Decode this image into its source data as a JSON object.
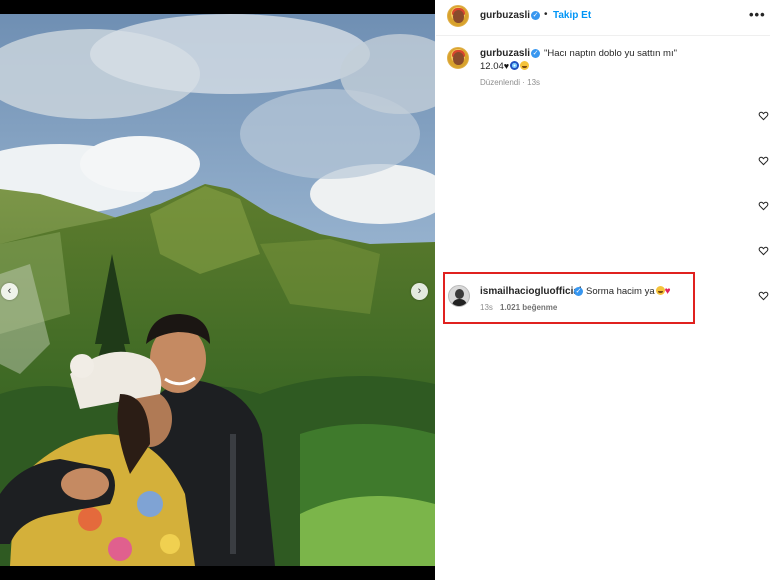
{
  "post": {
    "username": "gurbuzasli",
    "follow_label": "Takip Et",
    "more_label": "•••",
    "caption": "\"Hacı naptın doblo yu sattın mı\"",
    "caption_line2": "12.04",
    "edited_label": "Düzenlendi · 13s"
  },
  "comments": [
    {
      "username": "ismailhaciogluofficial",
      "text": "Sorma hacim ya",
      "time": "13s",
      "likes": "1.021 beğenme"
    }
  ],
  "icons": {
    "verified": "verified-badge-icon",
    "heart": "heart-outline-icon",
    "prev": "chevron-left-icon",
    "next": "chevron-right-icon"
  },
  "colors": {
    "accent": "#0095f6",
    "verified": "#3897f0",
    "highlight": "#e0211f"
  }
}
